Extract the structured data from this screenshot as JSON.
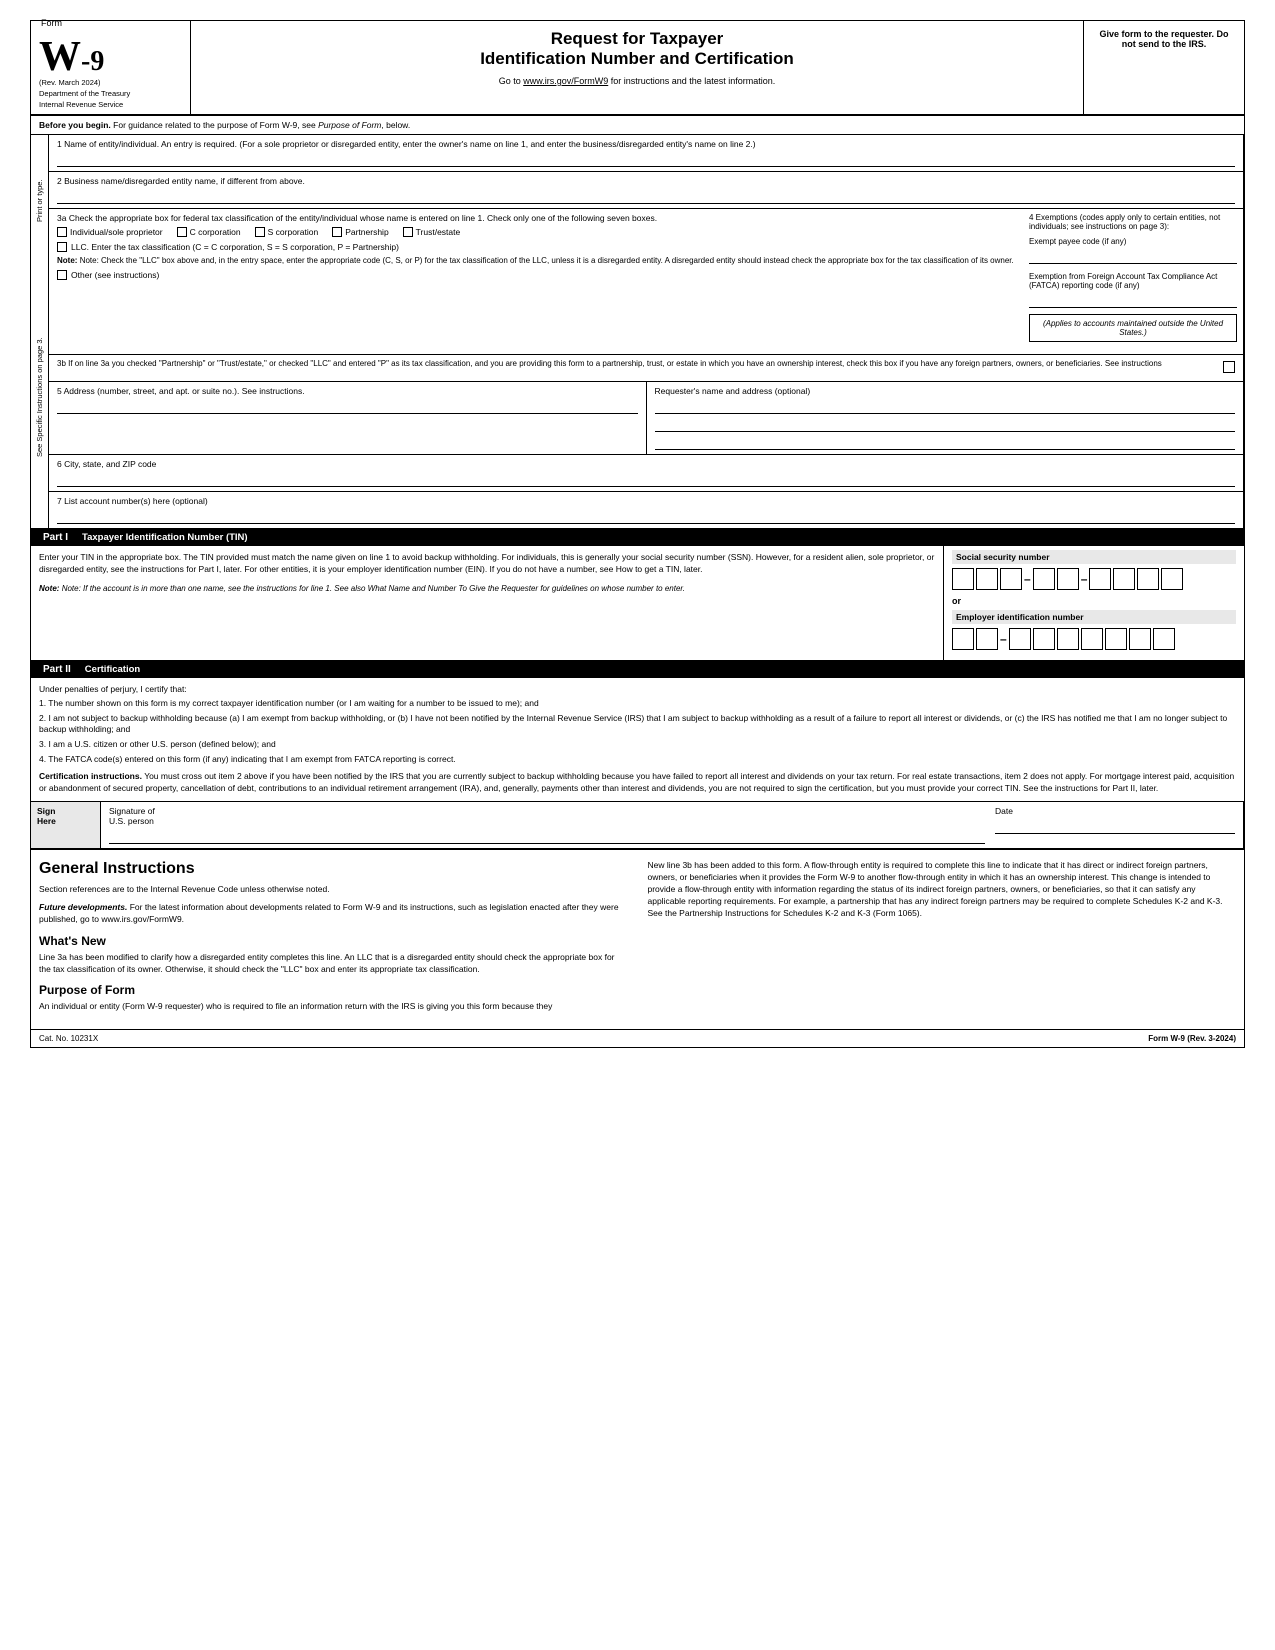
{
  "header": {
    "form_word": "Form",
    "form_number": "W-9",
    "rev": "(Rev. March 2024)",
    "dept1": "Department of the Treasury",
    "dept2": "Internal Revenue Service",
    "title1": "Request for Taxpayer",
    "title2": "Identification Number and Certification",
    "subtitle": "Go to www.irs.gov/FormW9 for instructions and the latest information.",
    "right_text": "Give form to the requester. Do not send to the IRS."
  },
  "before_begin": {
    "text": "Before you begin. For guidance related to the purpose of Form W-9, see Purpose of Form, below."
  },
  "fields": {
    "line1_label": "1  Name of entity/individual. An entry is required. (For a sole proprietor or disregarded entity, enter the owner's name on line 1, and enter the business/disregarded entity's name on line 2.)",
    "line2_label": "2  Business name/disregarded entity name, if different from above.",
    "line3a_label": "3a Check the appropriate box for federal tax classification of the entity/individual whose name is entered on line 1. Check only one of the following seven boxes.",
    "cb_individual": "Individual/sole proprietor",
    "cb_c_corp": "C corporation",
    "cb_s_corp": "S corporation",
    "cb_partnership": "Partnership",
    "cb_trust": "Trust/estate",
    "llc_text": "LLC. Enter the tax classification (C = C corporation, S = S corporation, P = Partnership)",
    "note_text": "Note: Check the \"LLC\" box above and, in the entry space, enter the appropriate code (C, S, or P) for the tax classification of the LLC, unless it is a disregarded entity. A disregarded entity should instead check the appropriate box for the tax classification of its owner.",
    "other_text": "Other (see instructions)",
    "line3b_text": "3b If on line 3a you checked \"Partnership\" or \"Trust/estate,\" or checked \"LLC\" and entered \"P\" as its tax classification, and you are providing this form to a partnership, trust, or estate in which you have an ownership interest, check this box if you have any foreign partners, owners, or beneficiaries. See instructions",
    "line5_label": "5  Address (number, street, and apt. or suite no.). See instructions.",
    "requester_label": "Requester's name and address (optional)",
    "line6_label": "6  City, state, and ZIP code",
    "line7_label": "7  List account number(s) here (optional)"
  },
  "side_label": {
    "text": "See Specific Instructions on page 3."
  },
  "side_label2": {
    "text": "Print or type."
  },
  "right_panel": {
    "title": "4  Exemptions (codes apply only to certain entities, not individuals; see instructions on page 3):",
    "exempt_payee": "Exempt payee code (if any)",
    "fatca_title": "Exemption from Foreign Account Tax Compliance Act (FATCA) reporting code (if any)",
    "applies_text": "(Applies to accounts maintained outside the United States.)"
  },
  "part1": {
    "label": "Part I",
    "title": "Taxpayer Identification Number (TIN)",
    "body_text": "Enter your TIN in the appropriate box. The TIN provided must match the name given on line 1 to avoid backup withholding. For individuals, this is generally your social security number (SSN). However, for a resident alien, sole proprietor, or disregarded entity, see the instructions for Part I, later. For other entities, it is your employer identification number (EIN). If you do not have a number, see How to get a TIN, later.",
    "note": "Note: If the account is in more than one name, see the instructions for line 1. See also What Name and Number To Give the Requester for guidelines on whose number to enter.",
    "ssn_label": "Social security number",
    "ein_label": "Employer identification number",
    "or_text": "or"
  },
  "part2": {
    "label": "Part II",
    "title": "Certification",
    "intro": "Under penalties of perjury, I certify that:",
    "item1": "1. The number shown on this form is my correct taxpayer identification number (or I am waiting for a number to be issued to me); and",
    "item2": "2. I am not subject to backup withholding because (a) I am exempt from backup withholding, or (b) I have not been notified by the Internal Revenue Service (IRS) that I am subject to backup withholding as a result of a failure to report all interest or dividends, or (c) the IRS has notified me that I am no longer subject to backup withholding; and",
    "item3": "3. I am a U.S. citizen or other U.S. person (defined below); and",
    "item4": "4. The FATCA code(s) entered on this form (if any) indicating that I am exempt from FATCA reporting is correct.",
    "cert_instructions_label": "Certification instructions.",
    "cert_instructions_text": "You must cross out item 2 above if you have been notified by the IRS that you are currently subject to backup withholding because you have failed to report all interest and dividends on your tax return. For real estate transactions, item 2 does not apply. For mortgage interest paid, acquisition or abandonment of secured property, cancellation of debt, contributions to an individual retirement arrangement (IRA), and, generally, payments other than interest and dividends, you are not required to sign the certification, but you must provide your correct TIN. See the instructions for Part II, later."
  },
  "sign": {
    "label1": "Sign",
    "label2": "Here",
    "sig_label": "Signature of",
    "sig_sublabel": "U.S. person",
    "date_label": "Date"
  },
  "general": {
    "title": "General Instructions",
    "section_refs": "Section references are to the Internal Revenue Code unless otherwise noted.",
    "future_label": "Future developments.",
    "future_text": "For the latest information about developments related to Form W-9 and its instructions, such as legislation enacted after they were published, go to www.irs.gov/FormW9.",
    "whats_new_title": "What's New",
    "whats_new_text": "Line 3a has been modified to clarify how a disregarded entity completes this line. An LLC that is a disregarded entity should check the appropriate box for the tax classification of its owner. Otherwise, it should check the \"LLC\" box and enter its appropriate tax classification.",
    "purpose_title": "Purpose of Form",
    "purpose_text": "An individual or entity (Form W-9 requester) who is required to file an information return with the IRS is giving you this form because they",
    "right_col_text": "New line 3b has been added to this form. A flow-through entity is required to complete this line to indicate that it has direct or indirect foreign partners, owners, or beneficiaries when it provides the Form W-9 to another flow-through entity in which it has an ownership interest. This change is intended to provide a flow-through entity with information regarding the status of its indirect foreign partners, owners, or beneficiaries, so that it can satisfy any applicable reporting requirements. For example, a partnership that has any indirect foreign partners may be required to complete Schedules K-2 and K-3. See the Partnership Instructions for Schedules K-2 and K-3 (Form 1065)."
  },
  "footer": {
    "cat_no": "Cat. No. 10231X",
    "form_ref": "Form W-9 (Rev. 3-2024)"
  }
}
